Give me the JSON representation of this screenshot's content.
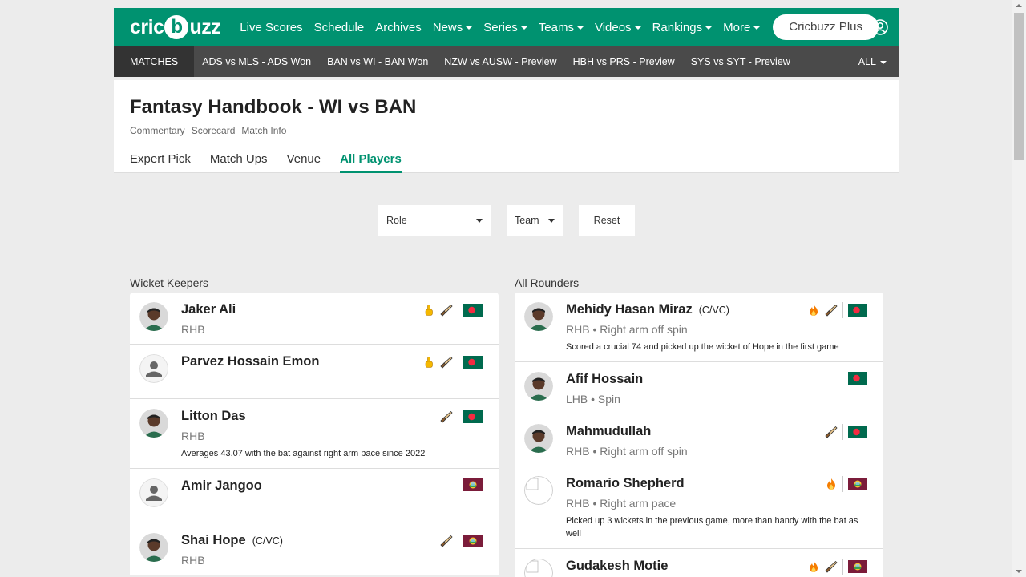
{
  "nav": {
    "logo_pre": "cric",
    "logo_ball": "b",
    "logo_post": "uzz",
    "items": [
      {
        "label": "Live Scores",
        "caret": false
      },
      {
        "label": "Schedule",
        "caret": false
      },
      {
        "label": "Archives",
        "caret": false
      },
      {
        "label": "News",
        "caret": true
      },
      {
        "label": "Series",
        "caret": true
      },
      {
        "label": "Teams",
        "caret": true
      },
      {
        "label": "Videos",
        "caret": true
      },
      {
        "label": "Rankings",
        "caret": true
      },
      {
        "label": "More",
        "caret": true
      }
    ],
    "plus": "Cricbuzz Plus"
  },
  "matchbar": {
    "label": "MATCHES",
    "matches": [
      "ADS vs MLS - ADS Won",
      "BAN vs WI - BAN Won",
      "NZW vs AUSW - Preview",
      "HBH vs PRS - Preview",
      "SYS vs SYT - Preview"
    ],
    "all": "ALL"
  },
  "header": {
    "title": "Fantasy Handbook - WI vs BAN",
    "links": [
      "Commentary",
      "Scorecard",
      "Match Info"
    ],
    "tabs": [
      "Expert Pick",
      "Match Ups",
      "Venue",
      "All Players"
    ],
    "active_tab": 3
  },
  "filters": {
    "role": "Role",
    "team": "Team",
    "reset": "Reset"
  },
  "colors": {
    "brand": "#009270",
    "ban_flag_green": "#006a4e",
    "ban_flag_red": "#f42a41",
    "wi_flag_maroon": "#7b1c3a"
  },
  "wicket_keepers": {
    "title": "Wicket Keepers",
    "players": [
      {
        "name": "Jaker Ali",
        "cvc": "",
        "meta": "RHB",
        "note": "",
        "icons": [
          "finger-icon",
          "bat-icon"
        ],
        "team": "BAN",
        "avatar": "photo"
      },
      {
        "name": "Parvez Hossain Emon",
        "cvc": "",
        "meta": "",
        "note": "",
        "icons": [
          "finger-icon",
          "bat-icon"
        ],
        "team": "BAN",
        "avatar": "placeholder"
      },
      {
        "name": "Litton Das",
        "cvc": "",
        "meta": "RHB",
        "note": "Averages 43.07 with the bat against right arm pace since 2022",
        "icons": [
          "bat-icon"
        ],
        "team": "BAN",
        "avatar": "photo"
      },
      {
        "name": "Amir Jangoo",
        "cvc": "",
        "meta": "",
        "note": "",
        "icons": [],
        "team": "WI",
        "avatar": "placeholder"
      },
      {
        "name": "Shai Hope",
        "cvc": "(C/VC)",
        "meta": "RHB",
        "note": "",
        "icons": [
          "bat-icon"
        ],
        "team": "WI",
        "avatar": "photo"
      }
    ]
  },
  "all_rounders": {
    "title": "All Rounders",
    "players": [
      {
        "name": "Mehidy Hasan Miraz",
        "cvc": "(C/VC)",
        "meta": "RHB • Right arm off spin",
        "note": "Scored a crucial 74 and picked up the wicket of Hope in the first game",
        "icons": [
          "fire-icon",
          "bat-icon"
        ],
        "team": "BAN",
        "avatar": "photo"
      },
      {
        "name": "Afif Hossain",
        "cvc": "",
        "meta": "LHB • Spin",
        "note": "",
        "icons": [],
        "team": "BAN",
        "avatar": "photo"
      },
      {
        "name": "Mahmudullah",
        "cvc": "",
        "meta": "RHB • Right arm off spin",
        "note": "",
        "icons": [
          "bat-icon"
        ],
        "team": "BAN",
        "avatar": "photo"
      },
      {
        "name": "Romario Shepherd",
        "cvc": "",
        "meta": "RHB • Right arm pace",
        "note": "Picked up 3 wickets in the previous game, more than handy with the bat as well",
        "icons": [
          "fire-icon"
        ],
        "team": "WI",
        "avatar": "broken"
      },
      {
        "name": "Gudakesh Motie",
        "cvc": "",
        "meta": "",
        "note": "",
        "icons": [
          "fire-icon",
          "bat-icon"
        ],
        "team": "WI",
        "avatar": "broken"
      }
    ]
  }
}
